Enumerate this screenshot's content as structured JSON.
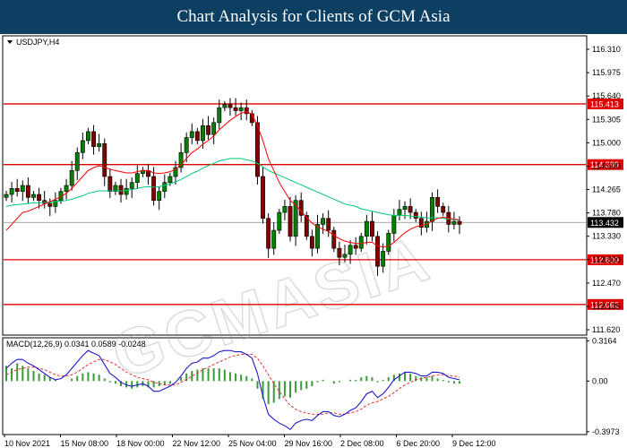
{
  "header": {
    "title": "Chart Analysis for Clients of GCM Asia"
  },
  "watermark": {
    "text": "GCMASIA"
  },
  "chart_data": [
    {
      "type": "candlestick",
      "symbol_label": "USDJPY,H4",
      "ylim": [
        111.55,
        116.55
      ],
      "y_ticks": [
        "116.310",
        "115.975",
        "115.640",
        "115.305",
        "115.000",
        "114.600",
        "114.265",
        "113.780",
        "113.330",
        "112.800",
        "112.470",
        "112.135",
        "111.620"
      ],
      "x_ticks": [
        "10 Nov 2021",
        "15 Nov 08:00",
        "18 Nov 00:00",
        "22 Nov 12:00",
        "25 Nov 04:00",
        "29 Nov 16:00",
        "2 Dec 08:00",
        "6 Dec 20:00",
        "9 Dec 12:00"
      ],
      "support_resistance": [
        115.413,
        114.399,
        112.809,
        112.062
      ],
      "current_price": 113.432,
      "colors": {
        "bull": "#008000",
        "bear": "#800000",
        "level": "#e00000",
        "fast_ma": "#ff0000",
        "slow_ma": "#00c878"
      },
      "close": [
        113.9,
        114.0,
        113.95,
        114.05,
        113.85,
        113.9,
        113.8,
        113.75,
        113.7,
        113.8,
        113.95,
        114.05,
        114.3,
        114.6,
        114.8,
        114.95,
        114.7,
        114.75,
        114.2,
        113.95,
        114.05,
        113.9,
        114.0,
        114.1,
        114.25,
        114.3,
        114.2,
        113.8,
        113.95,
        114.1,
        114.2,
        114.35,
        114.6,
        114.85,
        114.95,
        114.8,
        115.05,
        114.9,
        115.1,
        115.35,
        115.4,
        115.35,
        115.3,
        115.35,
        115.25,
        115.1,
        114.2,
        113.5,
        113.0,
        113.3,
        113.6,
        113.7,
        113.2,
        113.8,
        113.55,
        113.2,
        113.0,
        113.4,
        113.5,
        113.3,
        113.0,
        112.85,
        112.9,
        113.05,
        113.0,
        113.2,
        113.45,
        113.2,
        112.7,
        112.95,
        113.25,
        113.55,
        113.65,
        113.7,
        113.6,
        113.5,
        113.35,
        113.45,
        113.85,
        113.7,
        113.6,
        113.4,
        113.45,
        113.4
      ],
      "fast_ma": [
        113.3,
        113.4,
        113.5,
        113.6,
        113.62,
        113.66,
        113.7,
        113.74,
        113.78,
        113.82,
        113.86,
        113.92,
        114.0,
        114.1,
        114.2,
        114.3,
        114.35,
        114.38,
        114.36,
        114.32,
        114.3,
        114.28,
        114.26,
        114.26,
        114.28,
        114.3,
        114.3,
        114.26,
        114.25,
        114.26,
        114.28,
        114.32,
        114.4,
        114.5,
        114.6,
        114.66,
        114.74,
        114.8,
        114.88,
        114.98,
        115.06,
        115.14,
        115.2,
        115.26,
        115.28,
        115.24,
        115.05,
        114.8,
        114.5,
        114.3,
        114.1,
        113.95,
        113.8,
        113.72,
        113.62,
        113.52,
        113.42,
        113.36,
        113.32,
        113.28,
        113.22,
        113.16,
        113.12,
        113.1,
        113.08,
        113.08,
        113.1,
        113.1,
        113.04,
        113.02,
        113.04,
        113.1,
        113.18,
        113.26,
        113.32,
        113.36,
        113.38,
        113.4,
        113.46,
        113.5,
        113.52,
        113.5,
        113.49,
        113.47
      ],
      "slow_ma": [
        113.7,
        113.72,
        113.73,
        113.74,
        113.75,
        113.76,
        113.76,
        113.77,
        113.77,
        113.78,
        113.79,
        113.8,
        113.82,
        113.85,
        113.88,
        113.92,
        113.94,
        113.96,
        113.96,
        113.96,
        113.96,
        113.96,
        113.97,
        113.98,
        114.0,
        114.02,
        114.03,
        114.02,
        114.03,
        114.05,
        114.08,
        114.11,
        114.15,
        114.2,
        114.25,
        114.29,
        114.34,
        114.38,
        114.42,
        114.46,
        114.48,
        114.5,
        114.5,
        114.5,
        114.48,
        114.46,
        114.42,
        114.36,
        114.3,
        114.26,
        114.22,
        114.18,
        114.14,
        114.1,
        114.06,
        114.02,
        113.98,
        113.94,
        113.9,
        113.86,
        113.82,
        113.78,
        113.74,
        113.72,
        113.7,
        113.66,
        113.64,
        113.62,
        113.6,
        113.58,
        113.56,
        113.55,
        113.55,
        113.55,
        113.54,
        113.53,
        113.52,
        113.51,
        113.51,
        113.51,
        113.5,
        113.49,
        113.48,
        113.47
      ]
    },
    {
      "type": "macd",
      "label": "MACD(12,26,9) 0.0341 0.0589 -0.0248",
      "ylim": [
        -0.42,
        0.34
      ],
      "y_ticks": [
        "0.3164",
        "0.00",
        "-0.3973"
      ],
      "colors": {
        "histogram": "#3a9a3a",
        "signal": "#e03030",
        "macd": "#1a1acc"
      },
      "histogram": [
        0.12,
        0.1,
        0.14,
        0.12,
        0.1,
        0.08,
        0.06,
        0.05,
        0.03,
        0.01,
        0.0,
        0.0,
        0.02,
        0.04,
        0.06,
        0.07,
        0.06,
        0.05,
        0.02,
        -0.01,
        -0.02,
        -0.04,
        -0.05,
        -0.06,
        -0.05,
        -0.04,
        -0.05,
        -0.05,
        -0.04,
        -0.03,
        -0.02,
        0.0,
        0.03,
        0.06,
        0.08,
        0.09,
        0.1,
        0.1,
        0.1,
        0.1,
        0.09,
        0.07,
        0.06,
        0.05,
        0.04,
        0.02,
        -0.06,
        -0.14,
        -0.18,
        -0.17,
        -0.14,
        -0.12,
        -0.13,
        -0.09,
        -0.07,
        -0.06,
        -0.04,
        -0.01,
        0.01,
        0.0,
        -0.02,
        -0.01,
        0.0,
        0.01,
        0.01,
        0.03,
        0.04,
        0.03,
        -0.01,
        0.01,
        0.03,
        0.05,
        0.06,
        0.07,
        0.06,
        0.04,
        0.03,
        0.03,
        0.04,
        0.02,
        0.01,
        -0.01,
        -0.02,
        -0.02
      ],
      "macd": [
        0.1,
        0.14,
        0.17,
        0.17,
        0.14,
        0.12,
        0.09,
        0.06,
        0.03,
        0.01,
        0.02,
        0.05,
        0.1,
        0.15,
        0.2,
        0.24,
        0.22,
        0.2,
        0.13,
        0.06,
        0.03,
        -0.01,
        -0.03,
        -0.04,
        -0.03,
        -0.02,
        -0.04,
        -0.08,
        -0.08,
        -0.06,
        -0.04,
        -0.01,
        0.04,
        0.1,
        0.14,
        0.15,
        0.18,
        0.18,
        0.2,
        0.23,
        0.24,
        0.24,
        0.23,
        0.23,
        0.21,
        0.18,
        0.06,
        -0.12,
        -0.26,
        -0.3,
        -0.33,
        -0.35,
        -0.38,
        -0.33,
        -0.31,
        -0.3,
        -0.31,
        -0.27,
        -0.24,
        -0.24,
        -0.27,
        -0.28,
        -0.26,
        -0.23,
        -0.21,
        -0.16,
        -0.1,
        -0.08,
        -0.13,
        -0.1,
        -0.05,
        0.01,
        0.04,
        0.07,
        0.07,
        0.06,
        0.04,
        0.04,
        0.07,
        0.07,
        0.06,
        0.03,
        0.02,
        0.01
      ],
      "signal": [
        0.05,
        0.07,
        0.09,
        0.1,
        0.11,
        0.11,
        0.1,
        0.09,
        0.07,
        0.05,
        0.04,
        0.04,
        0.05,
        0.07,
        0.1,
        0.13,
        0.15,
        0.17,
        0.17,
        0.15,
        0.13,
        0.1,
        0.07,
        0.05,
        0.03,
        0.02,
        0.01,
        -0.01,
        -0.02,
        -0.03,
        -0.03,
        -0.03,
        -0.01,
        0.01,
        0.04,
        0.06,
        0.09,
        0.11,
        0.13,
        0.15,
        0.17,
        0.19,
        0.2,
        0.21,
        0.21,
        0.21,
        0.18,
        0.12,
        0.05,
        -0.02,
        -0.08,
        -0.14,
        -0.19,
        -0.22,
        -0.24,
        -0.25,
        -0.26,
        -0.26,
        -0.26,
        -0.25,
        -0.25,
        -0.26,
        -0.26,
        -0.25,
        -0.24,
        -0.22,
        -0.19,
        -0.17,
        -0.16,
        -0.14,
        -0.12,
        -0.09,
        -0.06,
        -0.03,
        -0.01,
        0.01,
        0.02,
        0.03,
        0.04,
        0.05,
        0.05,
        0.04,
        0.04,
        0.03
      ]
    }
  ]
}
